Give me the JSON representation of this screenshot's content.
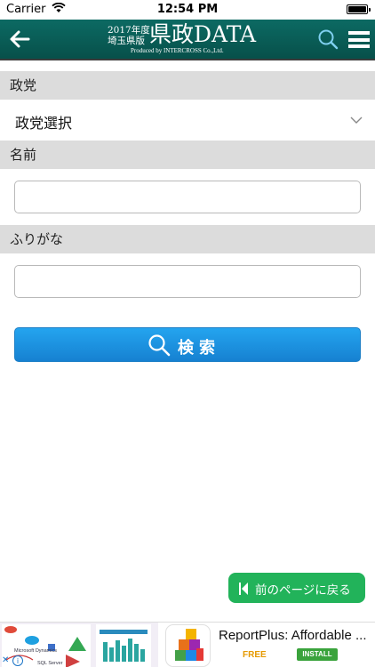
{
  "status_bar": {
    "carrier": "Carrier",
    "time": "12:54 PM"
  },
  "nav": {
    "logo_year": "2017年度",
    "logo_region": "埼玉県版",
    "logo_main": "県政DATA",
    "logo_producer": "Produced by INTERCROSS Co.,Ltd.",
    "back_icon": "arrow-left-icon",
    "search_icon": "search-icon",
    "menu_icon": "menu-icon"
  },
  "form": {
    "party_header": "政党",
    "party_select_value": "政党選択",
    "name_header": "名前",
    "name_value": "",
    "furigana_header": "ふりがな",
    "furigana_value": "",
    "search_label": "検索"
  },
  "back_page_label": "前のページに戻る",
  "ad": {
    "title": "ReportPlus: Affordable ...",
    "price": "FREE",
    "install": "INSTALL",
    "thumb_tags": [
      "Microsoft Dynamics",
      "SQL Server"
    ]
  },
  "colors": {
    "nav_bg": "#0a5f58",
    "search_button": "#1a8fe0",
    "back_page_button": "#22b35a",
    "section_header_bg": "#dcdcdc"
  }
}
